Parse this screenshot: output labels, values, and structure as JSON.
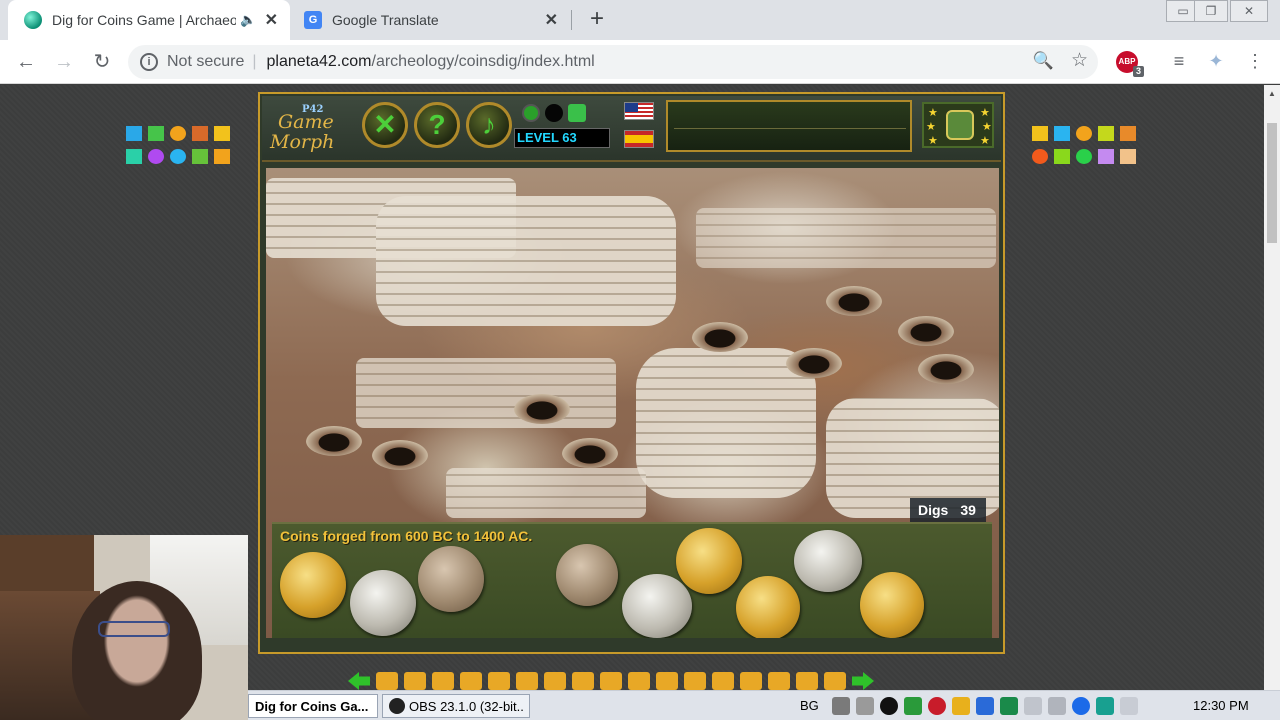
{
  "browser": {
    "tabs": [
      {
        "title": "Dig for Coins Game | Archaeology",
        "active": true
      },
      {
        "title": "Google Translate",
        "active": false
      }
    ],
    "new_tab": "+",
    "address": {
      "security": "Not secure",
      "domain": "planeta42.com",
      "path": "/archeology/coinsdig/index.html"
    },
    "extensions": {
      "abp_label": "ABP",
      "abp_badge": "3"
    }
  },
  "game": {
    "logo": {
      "brand": "P42",
      "line1": "Game",
      "line2": "Morph"
    },
    "buttons": [
      {
        "name": "close-game",
        "glyph": "✕"
      },
      {
        "name": "help",
        "glyph": "?"
      },
      {
        "name": "music",
        "glyph": "♪"
      }
    ],
    "level": "LEVEL 63",
    "digs_label": "Digs",
    "digs_value": "39",
    "coins_caption": "Coins forged from 600 BC to 1400 AC."
  },
  "taskbar": {
    "items": [
      {
        "label": "Dig for Coins Ga...",
        "active": true
      },
      {
        "label": "OBS 23.1.0 (32-bit...",
        "active": false
      }
    ],
    "language": "BG",
    "clock": "12:30 PM"
  },
  "colors": {
    "accent_gold": "#c79a2a",
    "level_text": "#22d8ff",
    "caption_text": "#f2c23a"
  }
}
